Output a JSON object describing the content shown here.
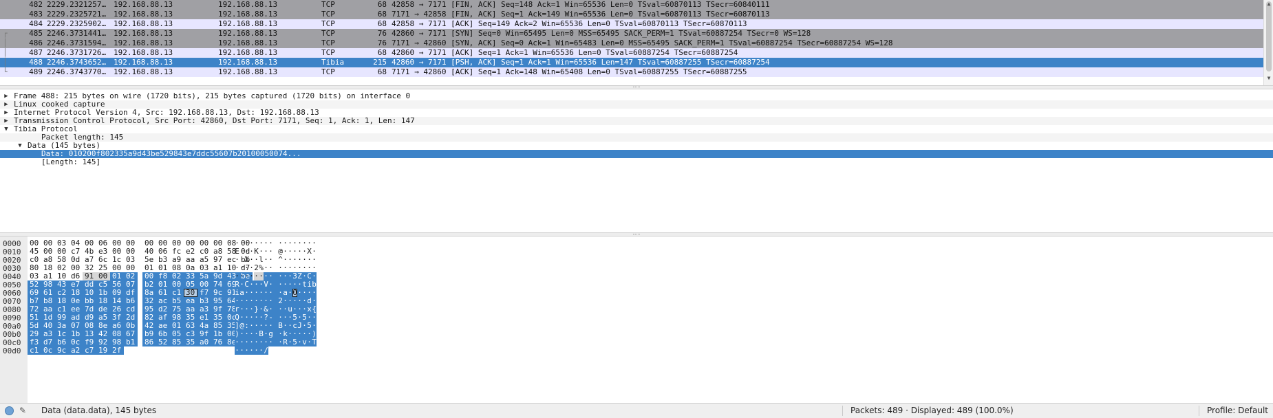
{
  "packet_list": {
    "rows": [
      {
        "tree": "",
        "no": "482",
        "time": "2229.2321257…",
        "src": "192.168.88.13",
        "dst": "192.168.88.13",
        "proto": "TCP",
        "len": "68",
        "info": "42858 → 7171 [FIN, ACK] Seq=148 Ack=1 Win=65536 Len=0 TSval=60870113 TSecr=60840111",
        "style": "gray"
      },
      {
        "tree": "",
        "no": "483",
        "time": "2229.2325721…",
        "src": "192.168.88.13",
        "dst": "192.168.88.13",
        "proto": "TCP",
        "len": "68",
        "info": "7171 → 42858 [FIN, ACK] Seq=1 Ack=149 Win=65536 Len=0 TSval=60870113 TSecr=60870113",
        "style": "gray"
      },
      {
        "tree": "",
        "no": "484",
        "time": "2229.2325902…",
        "src": "192.168.88.13",
        "dst": "192.168.88.13",
        "proto": "TCP",
        "len": "68",
        "info": "42858 → 7171 [ACK] Seq=149 Ack=2 Win=65536 Len=0 TSval=60870113 TSecr=60870113",
        "style": "lav"
      },
      {
        "tree": "┌",
        "no": "485",
        "time": "2246.3731441…",
        "src": "192.168.88.13",
        "dst": "192.168.88.13",
        "proto": "TCP",
        "len": "76",
        "info": "42860 → 7171 [SYN] Seq=0 Win=65495 Len=0 MSS=65495 SACK_PERM=1 TSval=60887254 TSecr=0 WS=128",
        "style": "gray"
      },
      {
        "tree": "│",
        "no": "486",
        "time": "2246.3731594…",
        "src": "192.168.88.13",
        "dst": "192.168.88.13",
        "proto": "TCP",
        "len": "76",
        "info": "7171 → 42860 [SYN, ACK] Seq=0 Ack=1 Win=65483 Len=0 MSS=65495 SACK_PERM=1 TSval=60887254 TSecr=60887254 WS=128",
        "style": "gray"
      },
      {
        "tree": "│",
        "no": "487",
        "time": "2246.3731726…",
        "src": "192.168.88.13",
        "dst": "192.168.88.13",
        "proto": "TCP",
        "len": "68",
        "info": "42860 → 7171 [ACK] Seq=1 Ack=1 Win=65536 Len=0 TSval=60887254 TSecr=60887254",
        "style": "lav"
      },
      {
        "tree": "│",
        "no": "488",
        "time": "2246.3743652…",
        "src": "192.168.88.13",
        "dst": "192.168.88.13",
        "proto": "Tibia",
        "len": "215",
        "info": "42860 → 7171 [PSH, ACK] Seq=1 Ack=1 Win=65536 Len=147 TSval=60887255 TSecr=60887254",
        "style": "sel"
      },
      {
        "tree": "└",
        "no": "489",
        "time": "2246.3743770…",
        "src": "192.168.88.13",
        "dst": "192.168.88.13",
        "proto": "TCP",
        "len": "68",
        "info": "7171 → 42860 [ACK] Seq=1 Ack=148 Win=65408 Len=0 TSval=60887255 TSecr=60887255",
        "style": "lav"
      }
    ]
  },
  "details": {
    "rows": [
      {
        "indent": 0,
        "twisty": "collapsed",
        "text": "Frame 488: 215 bytes on wire (1720 bits), 215 bytes captured (1720 bits) on interface 0",
        "style": ""
      },
      {
        "indent": 0,
        "twisty": "collapsed",
        "text": "Linux cooked capture",
        "style": "alt"
      },
      {
        "indent": 0,
        "twisty": "collapsed",
        "text": "Internet Protocol Version 4, Src: 192.168.88.13, Dst: 192.168.88.13",
        "style": ""
      },
      {
        "indent": 0,
        "twisty": "collapsed",
        "text": "Transmission Control Protocol, Src Port: 42860, Dst Port: 7171, Seq: 1, Ack: 1, Len: 147",
        "style": "alt"
      },
      {
        "indent": 0,
        "twisty": "expanded",
        "text": "Tibia Protocol",
        "style": ""
      },
      {
        "indent": 2,
        "twisty": "none",
        "text": "Packet length: 145",
        "style": "alt"
      },
      {
        "indent": 1,
        "twisty": "expanded",
        "text": "Data (145 bytes)",
        "style": ""
      },
      {
        "indent": 3,
        "twisty": "none",
        "text": "Data: 010200f802335a9d43be529843e7ddc55607b20100050074...",
        "style": "sel"
      },
      {
        "indent": 3,
        "twisty": "none",
        "text": "[Length: 145]",
        "style": ""
      }
    ]
  },
  "bytes": {
    "lines": [
      {
        "offset": "0000",
        "hex": [
          "00",
          "00",
          "03",
          "04",
          "00",
          "06",
          "00",
          "00",
          "00",
          "00",
          "00",
          "00",
          "00",
          "00",
          "08",
          "00"
        ],
        "ascii": "········ ········"
      },
      {
        "offset": "0010",
        "hex": [
          "45",
          "00",
          "00",
          "c7",
          "4b",
          "e3",
          "00",
          "00",
          "40",
          "06",
          "fc",
          "e2",
          "c0",
          "a8",
          "58",
          "0d"
        ],
        "ascii": "E···K··· @·····X·"
      },
      {
        "offset": "0020",
        "hex": [
          "c0",
          "a8",
          "58",
          "0d",
          "a7",
          "6c",
          "1c",
          "03",
          "5e",
          "b3",
          "a9",
          "aa",
          "a5",
          "97",
          "ec",
          "bb"
        ],
        "ascii": "··X··l·· ^·······"
      },
      {
        "offset": "0030",
        "hex": [
          "80",
          "18",
          "02",
          "00",
          "32",
          "25",
          "00",
          "00",
          "01",
          "01",
          "08",
          "0a",
          "03",
          "a1",
          "10",
          "d7"
        ],
        "ascii": "····2%·· ········"
      },
      {
        "offset": "0040",
        "hex": [
          "03",
          "a1",
          "10",
          "d6",
          "91",
          "00",
          "01",
          "02",
          "00",
          "f8",
          "02",
          "33",
          "5a",
          "9d",
          "43",
          "be"
        ],
        "ascii": "········ ···3Z·C·"
      },
      {
        "offset": "0050",
        "hex": [
          "52",
          "98",
          "43",
          "e7",
          "dd",
          "c5",
          "56",
          "07",
          "b2",
          "01",
          "00",
          "05",
          "00",
          "74",
          "69",
          "62"
        ],
        "ascii": "R·C···V· ·····tib"
      },
      {
        "offset": "0060",
        "hex": [
          "69",
          "61",
          "c2",
          "18",
          "10",
          "1b",
          "09",
          "df",
          "8a",
          "61",
          "c1",
          "30",
          "f7",
          "9c",
          "91",
          "15"
        ],
        "ascii": "ia······ ·a·0····"
      },
      {
        "offset": "0070",
        "hex": [
          "b7",
          "b8",
          "18",
          "0e",
          "bb",
          "18",
          "14",
          "b6",
          "32",
          "ac",
          "b5",
          "ea",
          "b3",
          "95",
          "64",
          "9c"
        ],
        "ascii": "········ 2·····d·"
      },
      {
        "offset": "0080",
        "hex": [
          "72",
          "aa",
          "c1",
          "ee",
          "7d",
          "de",
          "26",
          "cd",
          "95",
          "d2",
          "75",
          "aa",
          "a3",
          "9f",
          "78",
          "7b"
        ],
        "ascii": "r···}·&· ··u···x{"
      },
      {
        "offset": "0090",
        "hex": [
          "51",
          "1d",
          "99",
          "ad",
          "d9",
          "a5",
          "3f",
          "2d",
          "82",
          "af",
          "98",
          "35",
          "e1",
          "35",
          "0c",
          "ff"
        ],
        "ascii": "Q·····?- ···5·5··"
      },
      {
        "offset": "00a0",
        "hex": [
          "5d",
          "40",
          "3a",
          "07",
          "08",
          "8e",
          "a6",
          "0b",
          "42",
          "ae",
          "01",
          "63",
          "4a",
          "85",
          "35",
          "ed"
        ],
        "ascii": "]@:····· B··cJ·5·"
      },
      {
        "offset": "00b0",
        "hex": [
          "29",
          "a3",
          "1c",
          "1b",
          "13",
          "42",
          "08",
          "67",
          "b9",
          "6b",
          "05",
          "c3",
          "9f",
          "1b",
          "00",
          "29"
        ],
        "ascii": ")····B·g ·k·····)"
      },
      {
        "offset": "00c0",
        "hex": [
          "f3",
          "d7",
          "b6",
          "0c",
          "f9",
          "92",
          "98",
          "b1",
          "86",
          "52",
          "85",
          "35",
          "a0",
          "76",
          "8e",
          "54"
        ],
        "ascii": "········ ·R·5·v·T"
      },
      {
        "offset": "00d0",
        "hex": [
          "c1",
          "0c",
          "9c",
          "a2",
          "c7",
          "19",
          "2f"
        ],
        "ascii": "······/"
      }
    ],
    "selection_start": 70,
    "faint_start": 68,
    "focus_index": 107
  },
  "statusbar": {
    "message": "Data (data.data), 145 bytes",
    "packets": "Packets: 489 · Displayed: 489 (100.0%)",
    "profile": "Profile: Default",
    "expert_icon": "expert-info-icon",
    "comment_icon": "capture-comment-icon"
  }
}
